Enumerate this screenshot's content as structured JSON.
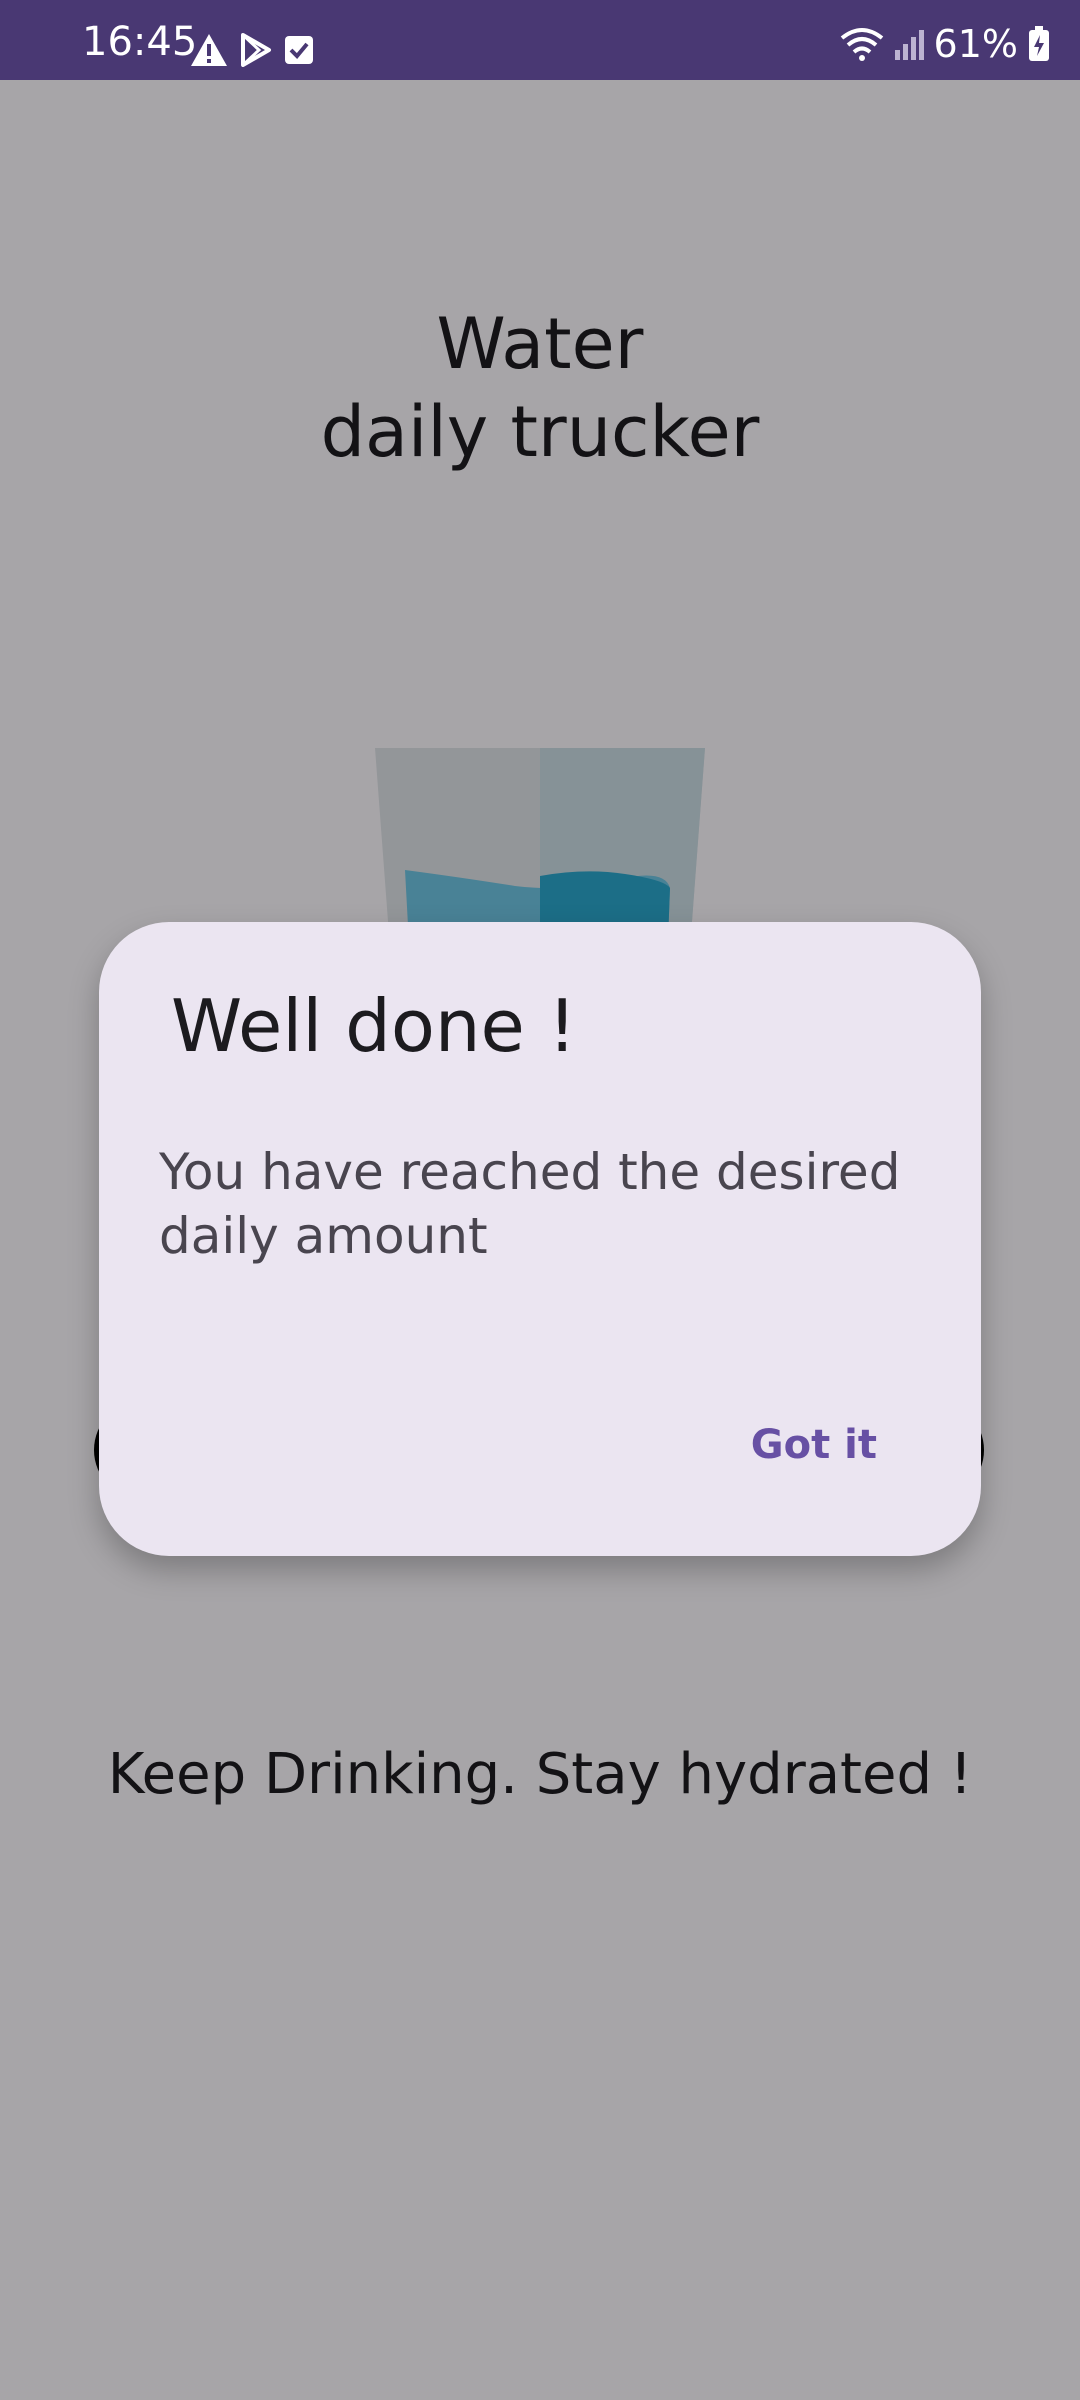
{
  "status_bar": {
    "time": "16:45",
    "left_icons": [
      "warning-icon",
      "play-store-icon",
      "checkbox-icon"
    ],
    "right_icons": [
      "wifi-icon",
      "signal-icon",
      "battery-icon"
    ],
    "battery_percent": "61%"
  },
  "app": {
    "title_line1": "Water",
    "title_line2": "daily trucker",
    "footer_text": "Keep Drinking. Stay hydrated !"
  },
  "dialog": {
    "title": "Well done !",
    "message": "You have reached the desired daily amount",
    "confirm_label": "Got it"
  },
  "colors": {
    "status_bar": "#493873",
    "dialog_background": "#ebe5f1",
    "accent": "#6750a4",
    "water": "#2aa3c8"
  }
}
